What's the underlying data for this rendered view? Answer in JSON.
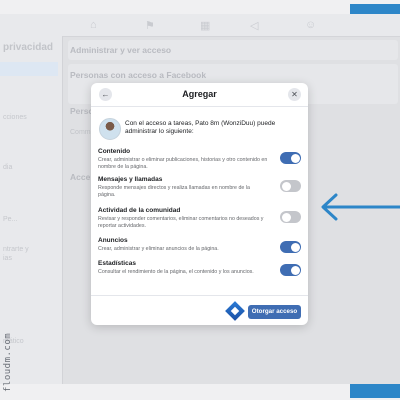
{
  "watermark": "floudm.com",
  "background": {
    "sidebar": {
      "title": "privacidad",
      "items": [
        "cciones",
        "dia",
        "Pe...",
        "ntrarte y",
        "ias",
        "mático"
      ]
    },
    "main": {
      "heading1": "Administrar y ver acceso",
      "heading2": "Personas con acceso a Facebook",
      "heading3": "Perso",
      "sub1": "Comm",
      "heading4": "Acce"
    }
  },
  "modal": {
    "title": "Agregar",
    "back_icon": "arrow-left-icon",
    "close_icon": "close-icon",
    "intro": "Con el acceso a tareas, Pato 8m (WonziDuu) puede administrar lo siguiente:",
    "permissions": [
      {
        "title": "Contenido",
        "description": "Crear, administrar o eliminar publicaciones, historias y otro contenido en nombre de la página.",
        "enabled": true
      },
      {
        "title": "Mensajes y llamadas",
        "description": "Responde mensajes directos y realiza llamadas en nombre de la página.",
        "enabled": false
      },
      {
        "title": "Actividad de la comunidad",
        "description": "Revisar y responder comentarios, eliminar comentarios no deseados y reportar actividades.",
        "enabled": false
      },
      {
        "title": "Anuncios",
        "description": "Crear, administrar y eliminar anuncios de la página.",
        "enabled": true
      },
      {
        "title": "Estadísticas",
        "description": "Consultar el rendimiento de la página, el contenido y los anuncios.",
        "enabled": true
      }
    ],
    "grant_button": "Otorgar acceso"
  },
  "colors": {
    "accent": "#3f6db3",
    "toggle_off": "#c4c6cb",
    "annotation": "#2d86c8"
  }
}
